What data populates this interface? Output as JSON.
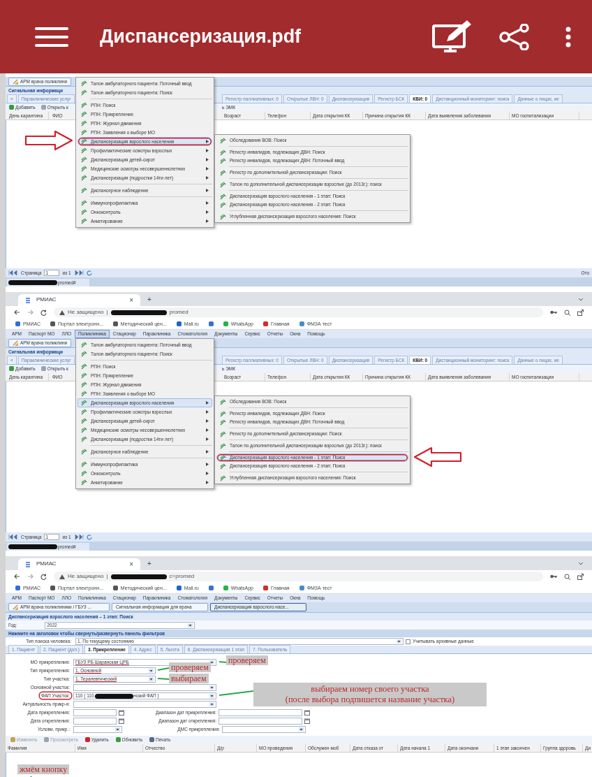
{
  "app_bar": {
    "title": "Диспансеризация.pdf"
  },
  "shots": [
    {
      "kind": "menu_shot",
      "toolbar_button": "АРМ врача поликлини",
      "signal_title": "Сигнальная информаци",
      "scroll_left": "«",
      "tabs_left": [
        {
          "label": "Параклинические услуг",
          "selected": false
        }
      ],
      "tabs_right": [
        {
          "label": "Регистр паллиативных: 0",
          "selected": false
        },
        {
          "label": "Открытые ЛВН: 0",
          "selected": false
        },
        {
          "label": "Диспансеризация",
          "selected": false
        },
        {
          "label": "Регистр БСК",
          "selected": false
        },
        {
          "label": "КВИ: 0",
          "selected": true
        },
        {
          "label": "Дистанционный мониторинг: поиск",
          "selected": false
        },
        {
          "label": "Данные о лицах, ие",
          "selected": false
        }
      ],
      "actions_left": [
        {
          "label": "Добавить",
          "color": "#3a9a3a"
        },
        {
          "label": "Открыть к",
          "color": "#9aa4b0"
        }
      ],
      "actions_right_fragment": "ь ЭМК",
      "columns_left": [
        "День карантина",
        "ФИО"
      ],
      "columns_right": [
        "Возраст",
        "Телефон",
        "Дата открытия КК",
        "Причина открытия КК",
        "Дата выявления заболевания",
        "МО госпитализации"
      ],
      "menu": {
        "groups": [
          [
            {
              "label": "Талон амбулаторного пациента: Поточный ввод",
              "has_submenu": false,
              "selected": false,
              "circled": false
            },
            {
              "label": "Талон амбулаторного пациента: Поиск",
              "has_submenu": false,
              "selected": false,
              "circled": false
            }
          ],
          [
            {
              "label": "РПН: Поиск",
              "has_submenu": false,
              "selected": false,
              "circled": false
            },
            {
              "label": "РПН: Прикрепление",
              "has_submenu": false,
              "selected": false,
              "circled": false
            },
            {
              "label": "РПН: Журнал движения",
              "has_submenu": false,
              "selected": false,
              "circled": false
            },
            {
              "label": "РПН: Заявления о выборе МО",
              "has_submenu": false,
              "selected": false,
              "circled": false
            },
            {
              "label": "Диспансеризация взрослого населения",
              "has_submenu": true,
              "selected": true,
              "circled": true
            },
            {
              "label": "Профилактические осмотры взрослых",
              "has_submenu": true,
              "selected": false,
              "circled": false
            },
            {
              "label": "Диспансеризация детей-сирот",
              "has_submenu": true,
              "selected": false,
              "circled": false
            },
            {
              "label": "Медицинские осмотры несовершеннолетних",
              "has_submenu": true,
              "selected": false,
              "circled": false
            },
            {
              "label": "Диспансеризация (подростки 14ти лет)",
              "has_submenu": true,
              "selected": false,
              "circled": false
            }
          ],
          [
            {
              "label": "Диспансерное наблюдение",
              "has_submenu": true,
              "selected": false,
              "circled": false
            }
          ],
          [
            {
              "label": "Иммунопрофилактика",
              "has_submenu": true,
              "selected": false,
              "circled": false
            },
            {
              "label": "Онкоконтроль",
              "has_submenu": true,
              "selected": false,
              "circled": false
            },
            {
              "label": "Анкетирование",
              "has_submenu": true,
              "selected": false,
              "circled": false
            }
          ]
        ]
      },
      "submenu": {
        "groups": [
          [
            {
              "label": "Обследования ВОВ: Поиск",
              "selected": false,
              "circled": false
            }
          ],
          [
            {
              "label": "Регистр инвалидов, подлежащих ДВН: Поиск",
              "selected": false,
              "circled": false
            },
            {
              "label": "Регистр инвалидов, подлежащих ДВН: Поточный ввод",
              "selected": false,
              "circled": false
            }
          ],
          [
            {
              "label": "Регистр по дополнительной диспансеризации: Поиск",
              "selected": false,
              "circled": false
            }
          ],
          [
            {
              "label": "Талон по дополнительной диспансеризации взрослых (до 2013г.): поиск",
              "selected": false,
              "circled": false
            }
          ],
          [
            {
              "label": "Диспансеризация взрослого населения - 1 этап: Поиск",
              "selected": false,
              "circled": false
            },
            {
              "label": "Диспансеризация взрослого населения - 2 этап: Поиск",
              "selected": false,
              "circled": false
            }
          ],
          [
            {
              "label": "Углубленная диспансеризация взрослого населения: Поиск",
              "selected": false,
              "circled": false
            }
          ]
        ]
      },
      "pointer_arrow": {
        "kind": "right"
      },
      "pager": {
        "page_label": "Страница",
        "page": "1",
        "of": "из 1",
        "right_fragment": "Ото"
      },
      "taskbar_tab": {
        "text_after_redaction": "promed#"
      }
    },
    {
      "kind": "menu_shot",
      "browser": {
        "tab": "РМИАС",
        "tab_close": "×",
        "new_tab": "+",
        "url_warning": "Не защищено",
        "url_divider": "|",
        "url_after_redaction": "promed",
        "bookmarks": [
          {
            "kind": "link",
            "label": "РМИАС",
            "color": "#2f6fd6"
          },
          {
            "kind": "link",
            "label": "Портал электронн...",
            "color": "#555555"
          },
          {
            "kind": "link",
            "label": "Методический цен...",
            "color": "#555555"
          },
          {
            "kind": "link",
            "label": "Mail.ru",
            "color": "#1e63d6"
          },
          {
            "kind": "icon",
            "color": "#3c6fd0"
          },
          {
            "kind": "link",
            "label": "WhatsApp",
            "color": "#25b34b"
          },
          {
            "kind": "link",
            "label": "Главная",
            "color": "#d12d2d"
          },
          {
            "kind": "link",
            "label": "ФМЗА тест",
            "color": "#4a8cc9"
          }
        ]
      },
      "menubar": [
        {
          "label": "АРМ",
          "selected": false
        },
        {
          "label": "Паспорт МО",
          "selected": false
        },
        {
          "label": "ЛЛО",
          "selected": false
        },
        {
          "label": "Поликлиника",
          "selected": true
        },
        {
          "label": "Стационар",
          "selected": false
        },
        {
          "label": "Параклиника",
          "selected": false
        },
        {
          "label": "Стоматология",
          "selected": false
        },
        {
          "label": "Документы",
          "selected": false
        },
        {
          "label": "Сервис",
          "selected": false
        },
        {
          "label": "Отчеты",
          "selected": false
        },
        {
          "label": "Окна",
          "selected": false
        },
        {
          "label": "Помощь",
          "selected": false
        }
      ],
      "toolbar_button": "АРМ врача поликлини",
      "signal_title": "Сигнальная информаци",
      "scroll_left": "«",
      "tabs_left": [
        {
          "label": "Параклинические услуг",
          "selected": false
        }
      ],
      "tabs_right": [
        {
          "label": "Регистр паллиативных: 0",
          "selected": false
        },
        {
          "label": "Открытые ЛВН: 0",
          "selected": false
        },
        {
          "label": "Диспансеризация",
          "selected": false
        },
        {
          "label": "Регистр БСК",
          "selected": false
        },
        {
          "label": "КВИ: 0",
          "selected": true
        },
        {
          "label": "Дистанционный мониторинг: поиск",
          "selected": false
        },
        {
          "label": "Данные о лицах, ие",
          "selected": false
        }
      ],
      "actions_left": [
        {
          "label": "Добавить",
          "color": "#3a9a3a"
        },
        {
          "label": "Открыть к",
          "color": "#9aa4b0"
        }
      ],
      "actions_right_fragment": "ь ЭМК",
      "columns_left": [
        "День карантина",
        "ФИО"
      ],
      "columns_right": [
        "Возраст",
        "Телефон",
        "Дата открытия КК",
        "Причина открытия КК",
        "Дата выявления заболевания",
        "МО госпитализации"
      ],
      "menu": {
        "groups": [
          [
            {
              "label": "Талон амбулаторного пациента: Поточный ввод",
              "has_submenu": false,
              "selected": false,
              "circled": false
            },
            {
              "label": "Талон амбулаторного пациента: Поиск",
              "has_submenu": false,
              "selected": false,
              "circled": false
            }
          ],
          [
            {
              "label": "РПН: Поиск",
              "has_submenu": false,
              "selected": false,
              "circled": false
            },
            {
              "label": "РПН: Прикрепление",
              "has_submenu": false,
              "selected": false,
              "circled": false
            },
            {
              "label": "РПН: Журнал движения",
              "has_submenu": false,
              "selected": false,
              "circled": false
            },
            {
              "label": "РПН: Заявления о выборе МО",
              "has_submenu": false,
              "selected": false,
              "circled": false
            },
            {
              "label": "Диспансеризация взрослого населения",
              "has_submenu": true,
              "selected": true,
              "circled": false
            },
            {
              "label": "Профилактические осмотры взрослых",
              "has_submenu": true,
              "selected": false,
              "circled": false
            },
            {
              "label": "Диспансеризация детей-сирот",
              "has_submenu": true,
              "selected": false,
              "circled": false
            },
            {
              "label": "Медицинские осмотры несовершеннолетних",
              "has_submenu": true,
              "selected": false,
              "circled": false
            },
            {
              "label": "Диспансеризация (подростки 14ти лет)",
              "has_submenu": true,
              "selected": false,
              "circled": false
            }
          ],
          [
            {
              "label": "Диспансерное наблюдение",
              "has_submenu": true,
              "selected": false,
              "circled": false
            }
          ],
          [
            {
              "label": "Иммунопрофилактика",
              "has_submenu": true,
              "selected": false,
              "circled": false
            },
            {
              "label": "Онкоконтроль",
              "has_submenu": true,
              "selected": false,
              "circled": false
            },
            {
              "label": "Анкетирование",
              "has_submenu": true,
              "selected": false,
              "circled": false
            }
          ]
        ]
      },
      "submenu": {
        "groups": [
          [
            {
              "label": "Обследования ВОВ: Поиск",
              "selected": false,
              "circled": false
            }
          ],
          [
            {
              "label": "Регистр инвалидов, подлежащих ДВН: Поиск",
              "selected": false,
              "circled": false
            },
            {
              "label": "Регистр инвалидов, подлежащих ДВН: Поточный ввод",
              "selected": false,
              "circled": false
            }
          ],
          [
            {
              "label": "Регистр по дополнительной диспансеризации: Поиск",
              "selected": false,
              "circled": false
            }
          ],
          [
            {
              "label": "Талон по дополнительной диспансеризации взрослых (до 2013г.): поиск",
              "selected": false,
              "circled": false
            }
          ],
          [
            {
              "label": "Диспансеризация взрослого населения - 1 этап: Поиск",
              "selected": true,
              "circled": true
            },
            {
              "label": "Диспансеризация взрослого населения - 2 этап: Поиск",
              "selected": false,
              "circled": false
            }
          ],
          [
            {
              "label": "Углубленная диспансеризация взрослого населения: Поиск",
              "selected": false,
              "circled": false
            }
          ]
        ]
      },
      "pointer_arrow": {
        "kind": "left"
      },
      "pager": {
        "page_label": "Страница",
        "page": "1",
        "of": "из 1"
      },
      "taskbar_tab": {
        "text_after_redaction": "promed#"
      }
    },
    {
      "kind": "form_shot",
      "browser": {
        "tab": "РМИАС",
        "tab_close": "×",
        "new_tab": "+",
        "url_warning": "Не защищено",
        "url_divider": "|",
        "url_after_redaction": "c=promed",
        "bookmarks": [
          {
            "kind": "link",
            "label": "РМИАС",
            "color": "#2f6fd6"
          },
          {
            "kind": "link",
            "label": "Портал электронн...",
            "color": "#555555"
          },
          {
            "kind": "link",
            "label": "Методический цен...",
            "color": "#555555"
          },
          {
            "kind": "link",
            "label": "Mail.ru",
            "color": "#1e63d6"
          },
          {
            "kind": "icon",
            "color": "#3c6fd0"
          },
          {
            "kind": "link",
            "label": "WhatsApp",
            "color": "#25b34b"
          },
          {
            "kind": "link",
            "label": "Главная",
            "color": "#d12d2d"
          },
          {
            "kind": "link",
            "label": "ФМЗА тест",
            "color": "#4a8cc9"
          }
        ]
      },
      "menubar": [
        {
          "label": "АРМ",
          "selected": false
        },
        {
          "label": "Паспорт МО",
          "selected": false
        },
        {
          "label": "ЛЛО",
          "selected": false
        },
        {
          "label": "Поликлиника",
          "selected": false
        },
        {
          "label": "Стационар",
          "selected": false
        },
        {
          "label": "Параклиника",
          "selected": false
        },
        {
          "label": "Стоматология",
          "selected": false
        },
        {
          "label": "Документы",
          "selected": false
        },
        {
          "label": "Сервис",
          "selected": false
        },
        {
          "label": "Отчеты",
          "selected": false
        },
        {
          "label": "Окна",
          "selected": false
        },
        {
          "label": "Помощь",
          "selected": false
        }
      ],
      "window_tabs": [
        {
          "label": "АРМ врача поликлиники / ГБУЗ ...",
          "selected": false
        },
        {
          "label": "Сигнальная информация для врача",
          "selected": false
        },
        {
          "label": "Диспансеризация взрослого насе...",
          "selected": true
        }
      ],
      "title": "Диспансеризация взрослого населения – 1 этап: Поиск",
      "year": {
        "label": "Год:",
        "value": "2022"
      },
      "filter_bar": "Нажмите на заголовок чтобы свернуть/развернуть панель фильтров",
      "search_type": {
        "label": "Тип поиска человека:",
        "value": "1. По текущему состоянию",
        "checkbox_label": "Учитывать архивные данные",
        "checked": false
      },
      "form_tabs": [
        {
          "label": "1. Пациент",
          "selected": false
        },
        {
          "label": "2. Пациент (доп.)",
          "selected": false
        },
        {
          "label": "3. Прикрепление",
          "selected": true
        },
        {
          "label": "4. Адрес",
          "selected": false
        },
        {
          "label": "5. Льгота",
          "selected": false
        },
        {
          "label": "6. Диспансеризация 1 этап",
          "selected": false
        },
        {
          "label": "7. Пользователь",
          "selected": false
        }
      ],
      "form_rows": [
        {
          "left": {
            "label": "МО прикрепления:",
            "value": "ГБУЗ РБ Шаранская ЦРБ",
            "kind": "combo",
            "underlined": true,
            "circled": false
          }
        },
        {
          "left": {
            "label": "Тип прикрепления:",
            "value": "1. Основной",
            "kind": "narrow",
            "underlined": true,
            "circled": false
          }
        },
        {
          "left": {
            "label": "Тип участка:",
            "value": "1. Терапевтический",
            "kind": "narrow",
            "underlined": true,
            "circled": false
          }
        },
        {
          "left": {
            "label": "Основной участок:",
            "kind": "combo",
            "circled": false
          }
        },
        {
          "left": {
            "label": "ФАП Участок:",
            "value": "110 ( 110.",
            "value_after_redaction": "нский ФАП )",
            "kind": "combo",
            "underlined": false,
            "circled": true
          }
        },
        {
          "left": {
            "label": "Актуальность прикр-я:",
            "kind": "combo",
            "circled": false
          }
        },
        {
          "left": {
            "label": "Дата прикрепления:",
            "kind": "date",
            "circled": false
          },
          "right": {
            "label": "Диапазон дат прикрепления:",
            "kind": "date"
          }
        },
        {
          "left": {
            "label": "Дата открепления:",
            "kind": "date",
            "circled": false
          },
          "right": {
            "label": "Диапазон дат открепления:",
            "kind": "date"
          }
        },
        {
          "left": {
            "label": "Услови. прикр.:",
            "kind": "short_combo",
            "circled": false
          },
          "right": {
            "label": "ДМС прикрепления:",
            "kind": "combo"
          }
        }
      ],
      "annotations": [
        {
          "text": "проверяем"
        },
        {
          "text": "проверяем"
        },
        {
          "text": "выбираем"
        }
      ],
      "note_box": {
        "lines": [
          "выбираем номер своего участка",
          "(после выбора подпишется название участка)"
        ]
      },
      "actions": [
        {
          "label": "Изменить",
          "color": "#c8a050",
          "disabled": true
        },
        {
          "label": "Просмотреть",
          "color": "#9aa4b0",
          "disabled": true
        },
        {
          "label": "Удалить",
          "color": "#d02020",
          "disabled": false
        },
        {
          "label": "Обновить",
          "color": "#3a9a3a",
          "disabled": false
        },
        {
          "label": "Печать",
          "color": "#5a6a80",
          "disabled": false
        }
      ],
      "columns": [
        "Фамилия",
        "Имя",
        "Отчество",
        "Д/р",
        "МО проведения",
        "Обслужен моб",
        "Дата отказа от",
        "Дата начала 1",
        "Дата окончани",
        "1 этап закончен",
        "Группа здоровь",
        "Ди"
      ],
      "bottom_note": {
        "text": "жмём кнопку"
      }
    }
  ]
}
